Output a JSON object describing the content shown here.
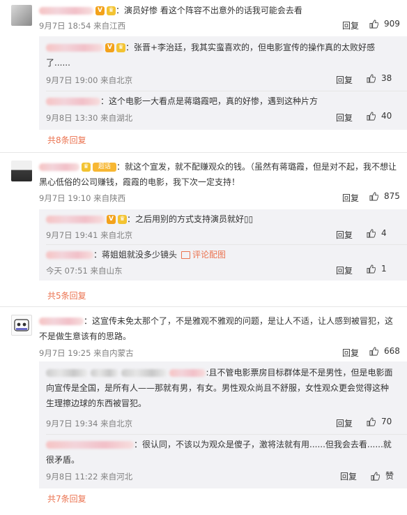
{
  "actions": {
    "reply": "回复"
  },
  "comments": [
    {
      "text": "：演员好惨 看这个阵容不出意外的话我可能会去看",
      "time": "9月7日 18:54 来自江西",
      "likes": "909",
      "replies": [
        {
          "text_line1": "：张晋+李治廷，我其实蛮喜欢的，但电影宣传的操作真的太败好感",
          "text_line2": "了......",
          "time": "9月7日 19:00 来自北京",
          "likes": "38"
        },
        {
          "text_line1": "：这个电影一大看点是蒋璐霞吧，真的好惨，遇到这种片方",
          "time": "9月8日 13:30 来自湖北",
          "likes": "40"
        }
      ],
      "more": "共8条回复"
    },
    {
      "badge": "超话",
      "text_line1": "：就这个宣发，就不配赚观众的钱。（虽然有蒋璐霞，但是对不起，我不想让",
      "text_line2": "黑心低俗的公司赚钱，霞霞的电影，我下次一定支持！",
      "time": "9月7日 19:10 来自陕西",
      "likes": "875",
      "replies": [
        {
          "text_line1": "：之后用别的方式支持演员就好▯▯",
          "time": "9月7日 19:41 来自北京",
          "likes": "4"
        },
        {
          "text_line1": "：蒋姐姐就没多少镜头",
          "pic_label": "评论配图",
          "time": "今天 07:51 来自山东",
          "likes": "1"
        }
      ],
      "more": "共5条回复"
    },
    {
      "text_line1": "：这宣传未免太那个了，不是雅观不雅观的问题，是让人不适，让人感到被冒犯，这",
      "text_line2": "不是做生意该有的思路。",
      "time": "9月7日 19:25 来自内蒙古",
      "likes": "668",
      "replies": [
        {
          "text_line1": ":且不管电影票房目标群体是不是男性，但是电影面",
          "text_line2": "向宣传是全国，是所有人——那就有男，有女。男性观众尚且不舒服，女性观众更会觉得这种",
          "text_line3": "生理擦边球的东西被冒犯。",
          "time": "9月7日 19:34 来自北京",
          "likes": "70"
        },
        {
          "text_line1": "：很认同，不该以为观众是傻子，激将法就有用......但我会去看......就",
          "text_line2": "很矛盾。",
          "time": "9月8日 11:22 来自河北",
          "likes": "赞"
        }
      ],
      "more": "共7条回复"
    }
  ]
}
